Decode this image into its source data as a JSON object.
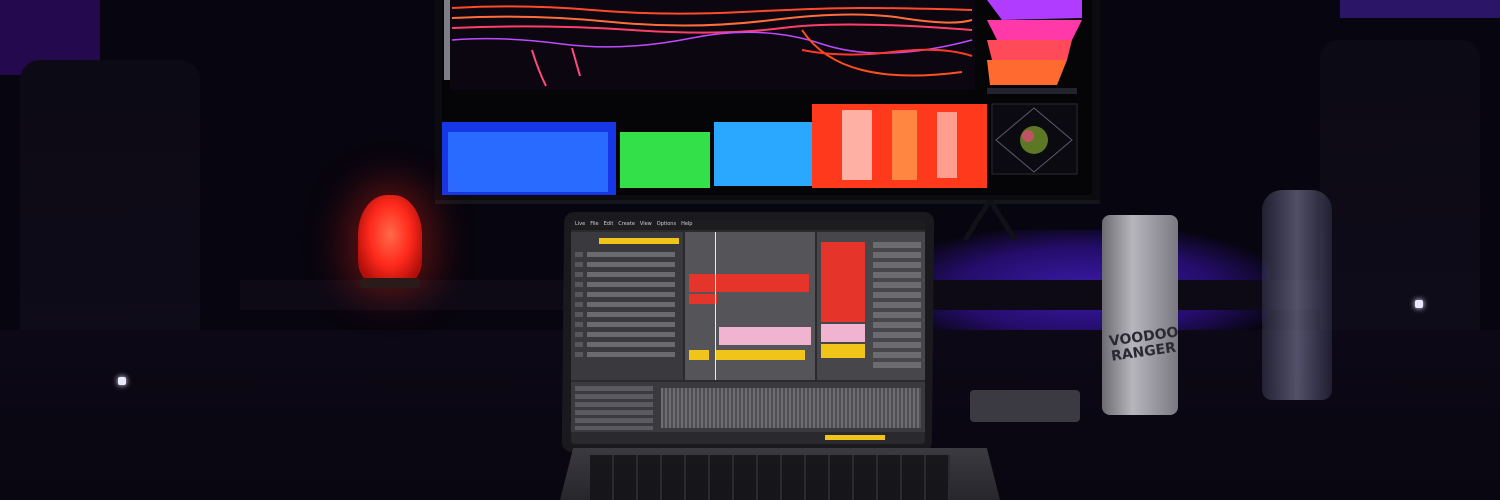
{
  "scene": {
    "description_alt": "",
    "can_label_lines": [
      "VOODOO",
      "RANGER"
    ]
  },
  "laptop_daw": {
    "menu_items": [
      "Live",
      "File",
      "Edit",
      "Create",
      "View",
      "Options",
      "Help"
    ]
  },
  "colors": {
    "room_glow": "#3b1aa8",
    "lamp": "#ff2a1c",
    "clip_red": "#e5352b",
    "clip_pink": "#f0b3d0",
    "clip_yellow": "#f0c419"
  }
}
